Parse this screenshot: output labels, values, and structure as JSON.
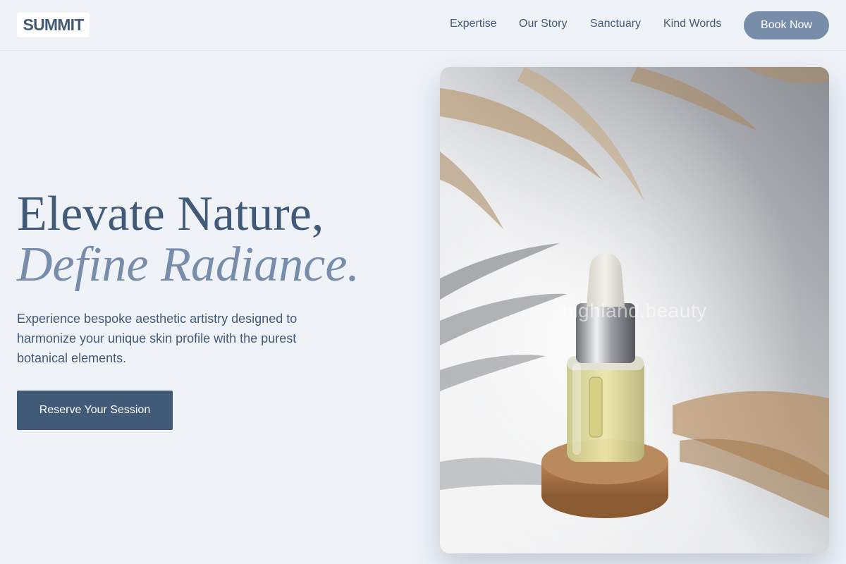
{
  "brand": {
    "logo_text": "SUMMIT"
  },
  "nav": {
    "links": [
      "Expertise",
      "Our Story",
      "Sanctuary",
      "Kind Words"
    ],
    "book_label": "Book Now"
  },
  "hero": {
    "title_line1": "Elevate Nature,",
    "title_line2": "Define Radiance.",
    "description": "Experience bespoke aesthetic artistry designed to harmonize your unique skin profile with the purest botanical elements.",
    "cta_label": "Reserve Your Session"
  },
  "image": {
    "subject": "serum dropper bottle on cork with dried pampas grass",
    "watermark": "highland.beauty"
  },
  "colors": {
    "background": "#eff3f8",
    "primary": "#415a77",
    "accent": "#778da9",
    "white": "#ffffff"
  }
}
